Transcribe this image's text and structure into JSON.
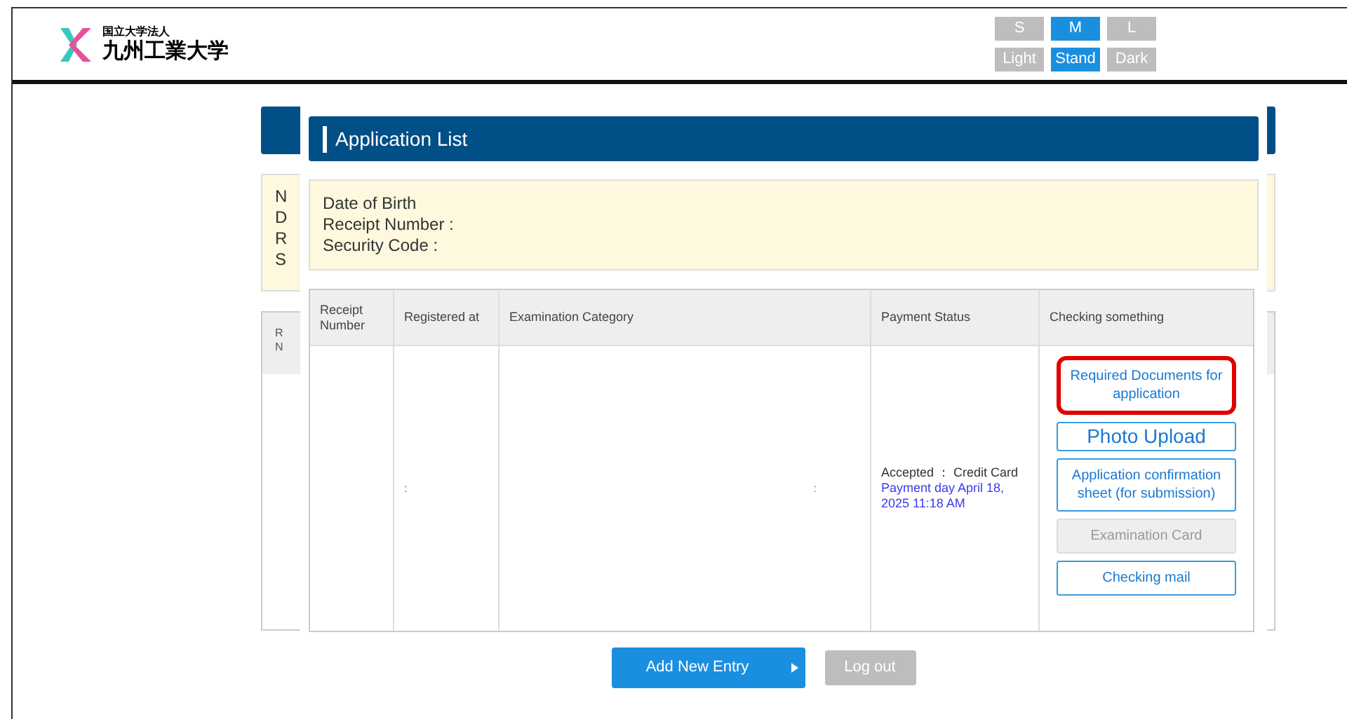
{
  "header": {
    "logo_small": "国立大学法人",
    "logo_name": "九州工業大学",
    "size_buttons": [
      {
        "label": "S",
        "selected": false
      },
      {
        "label": "M",
        "selected": true
      },
      {
        "label": "L",
        "selected": false
      }
    ],
    "theme_buttons": [
      {
        "label": "Light",
        "selected": false
      },
      {
        "label": "Stand",
        "selected": true
      },
      {
        "label": "Dark",
        "selected": false
      }
    ]
  },
  "background_page": {
    "card_letters": [
      "N",
      "D",
      "R",
      "S"
    ],
    "table_header_letters": [
      "R",
      "N"
    ]
  },
  "dialog": {
    "title": "Application List",
    "info_lines": [
      "Date of Birth",
      "Receipt Number :",
      "Security Code :"
    ],
    "table": {
      "columns": [
        "Receipt Number",
        "Registered at",
        "Examination Category",
        "Payment Status",
        "Checking something"
      ],
      "rows": [
        {
          "receipt_number": "",
          "registered_at": ":",
          "category": ":",
          "payment_status": "Accepted ： Credit Card",
          "payment_date": "Payment day April 18, 2025 11:18 AM",
          "actions": [
            {
              "label": "Required Documents for application",
              "kind": "normal",
              "disabled": false,
              "highlighted": true
            },
            {
              "label": "Photo Upload",
              "kind": "large",
              "disabled": false,
              "highlighted": false
            },
            {
              "label": "Application confirmation sheet (for submission)",
              "kind": "normal",
              "disabled": false,
              "highlighted": false
            },
            {
              "label": "Examination Card",
              "kind": "normal",
              "disabled": true,
              "highlighted": false
            },
            {
              "label": "Checking mail",
              "kind": "normal",
              "disabled": false,
              "highlighted": false
            }
          ]
        }
      ]
    }
  },
  "footer_buttons": [
    {
      "label": "Add New Entry",
      "kind": "primary"
    },
    {
      "label": "Log out",
      "kind": "secondary"
    }
  ]
}
